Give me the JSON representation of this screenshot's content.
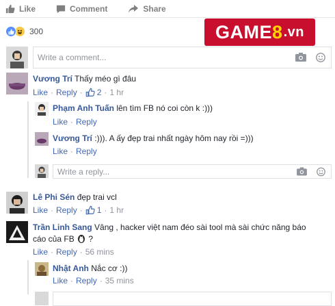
{
  "actions": {
    "like": "Like",
    "comment": "Comment",
    "share": "Share"
  },
  "reactions": {
    "count": "300"
  },
  "watermark": {
    "game": "GAME",
    "num": "8",
    "vn": ".vn"
  },
  "write_comment_placeholder": "Write a comment...",
  "write_reply_placeholder": "Write a reply...",
  "meta": {
    "like": "Like",
    "reply": "Reply",
    "sep": "·"
  },
  "comments": [
    {
      "name": "Vương Trí",
      "text": "Thấy méo gì đâu",
      "likes": "2",
      "time": "1 hr"
    },
    {
      "name": "Phạm Anh Tuấn",
      "text": "lên tìm FB nó coi còn k :)))"
    },
    {
      "name": "Vương Trí",
      "text": ":))). A ấy đẹp trai nhất ngày hôm nay rồi =)))"
    },
    {
      "name": "Lê Phi Sén",
      "text": "đẹp trai vcl",
      "likes": "1",
      "time": "1 hr"
    },
    {
      "name": "Trần Linh Sang",
      "text_line1": "Vâng , hacker việt nam đéo sài tool mà sài chức năng báo",
      "text_line2": "cáo của FB",
      "text_line2_end": "?",
      "time": "56 mins"
    },
    {
      "name": "Nhật Anh",
      "text": "Nắc cơ :))",
      "time": "35 mins"
    }
  ]
}
